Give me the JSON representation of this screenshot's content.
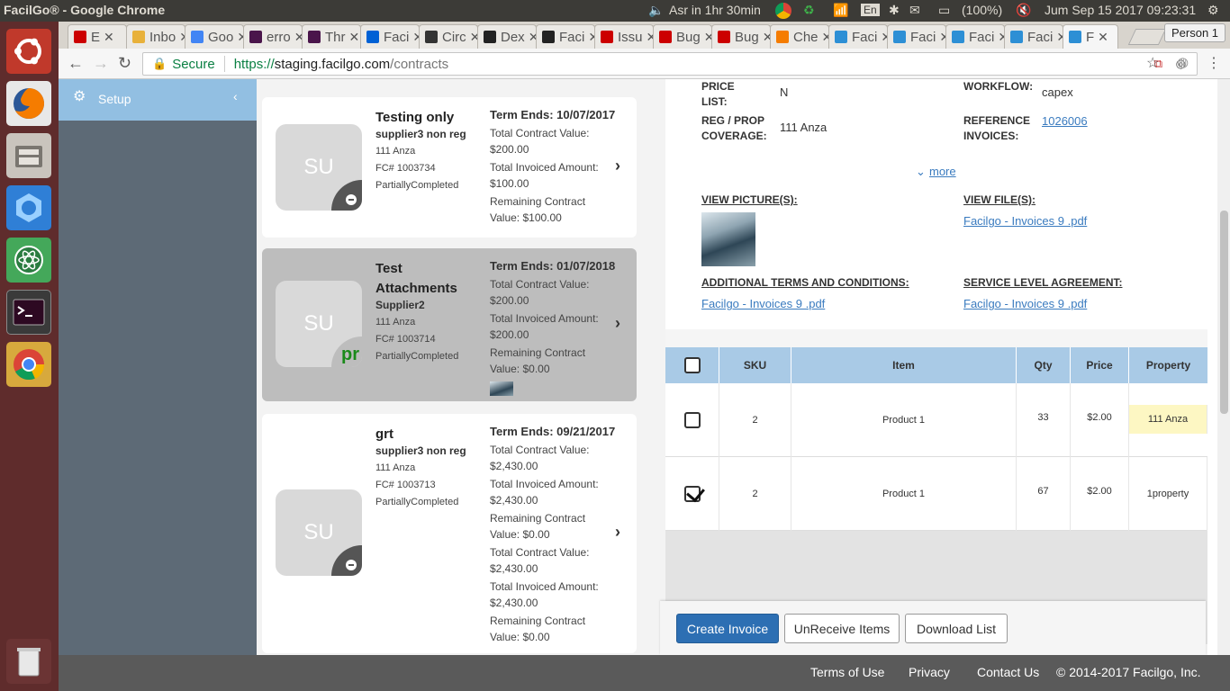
{
  "os_bar": {
    "window_title": "FacilGo® - Google Chrome",
    "prayer": "Asr in 1hr 30min",
    "keyboard": "En",
    "battery": "(100%)",
    "clock": "Jum Sep 15 2017 09:23:31"
  },
  "browser": {
    "tabs": [
      {
        "label": "E",
        "icon": "redhat-icon"
      },
      {
        "label": "Inbo",
        "icon": "mail-icon"
      },
      {
        "label": "Goo",
        "icon": "google-icon"
      },
      {
        "label": "erro",
        "icon": "slack-icon"
      },
      {
        "label": "Thr",
        "icon": "slack-icon"
      },
      {
        "label": "Faci",
        "icon": "box-icon"
      },
      {
        "label": "Circ",
        "icon": "circleci-icon"
      },
      {
        "label": "Dex",
        "icon": "github-icon"
      },
      {
        "label": "Faci",
        "icon": "github-icon"
      },
      {
        "label": "Issu",
        "icon": "redhat-icon"
      },
      {
        "label": "Bug",
        "icon": "redhat-icon"
      },
      {
        "label": "Bug",
        "icon": "redhat-icon"
      },
      {
        "label": "Che",
        "icon": "play-icon"
      },
      {
        "label": "Faci",
        "icon": "facilgo-icon"
      },
      {
        "label": "Faci",
        "icon": "facilgo-icon"
      },
      {
        "label": "Faci",
        "icon": "facilgo-icon"
      },
      {
        "label": "Faci",
        "icon": "facilgo-icon"
      },
      {
        "label": "F",
        "icon": "facilgo-icon"
      }
    ],
    "person": "Person 1",
    "secure_label": "Secure",
    "url_scheme": "https://",
    "url_host": "staging.facilgo.com",
    "url_path": "/contracts"
  },
  "sidebar": {
    "setup_label": "Setup"
  },
  "contracts": [
    {
      "avatar": "SU",
      "badge": "minus",
      "title": "Testing only",
      "supplier": "supplier3 non reg",
      "property": "111 Anza",
      "fc": "FC# 1003734",
      "status": "PartiallyCompleted",
      "term": "Term Ends: 10/07/2017",
      "values": [
        "Total Contract Value: $200.00",
        "Total Invoiced Amount: $100.00",
        "Remaining Contract Value: $100.00"
      ]
    },
    {
      "avatar": "SU",
      "badge": "pr",
      "title": "Test Attachments",
      "supplier": "Supplier2",
      "property": "111 Anza",
      "fc": "FC# 1003714",
      "status": "PartiallyCompleted",
      "term": "Term Ends: 01/07/2018",
      "values": [
        "Total Contract Value: $200.00",
        "Total Invoiced Amount: $200.00",
        "Remaining Contract Value: $0.00"
      ]
    },
    {
      "avatar": "SU",
      "badge": "minus",
      "title": "grt",
      "supplier": "supplier3 non reg",
      "property": "111 Anza",
      "fc": "FC# 1003713",
      "status": "PartiallyCompleted",
      "term": "Term Ends: 09/21/2017",
      "values": [
        "Total Contract Value: $2,430.00",
        "Total Invoiced Amount: $2,430.00",
        "Remaining Contract Value: $0.00",
        "Total Contract Value: $2,430.00",
        "Total Invoiced Amount: $2,430.00",
        "Remaining Contract Value: $0.00"
      ]
    }
  ],
  "detail": {
    "price_list_label": "PRICE LIST:",
    "price_list_value": "N",
    "workflow_label": "WORKFLOW:",
    "workflow_value": "capex",
    "reg_label": "REG / PROP COVERAGE:",
    "reg_value": "111 Anza",
    "ref_label": "REFERENCE INVOICES:",
    "ref_value": "1026006",
    "more": "more",
    "pictures_label": "VIEW PICTURE(S):",
    "files_label": "VIEW FILE(S):",
    "files_link": "Facilgo  - Invoices  9 .pdf",
    "terms_label": "ADDITIONAL TERMS AND CONDITIONS:",
    "terms_link": "Facilgo  - Invoices  9 .pdf",
    "sla_label": "SERVICE LEVEL AGREEMENT:",
    "sla_link": "Facilgo  - Invoices  9 .pdf"
  },
  "items_table": {
    "columns": [
      "SKU",
      "Item",
      "Qty",
      "Price",
      "Property"
    ],
    "rows": [
      {
        "checked": false,
        "sku": "2",
        "item": "Product 1",
        "qty": "33",
        "price": "$2.00",
        "property": "111 Anza"
      },
      {
        "checked": true,
        "sku": "2",
        "item": "Product 1",
        "qty": "67",
        "price": "$2.00",
        "property": "1property"
      }
    ]
  },
  "actions": {
    "create_invoice": "Create Invoice",
    "unreceive": "UnReceive Items",
    "download": "Download List"
  },
  "footer": {
    "terms": "Terms of Use",
    "privacy": "Privacy",
    "contact": "Contact Us",
    "copyright": "© 2014-2017 Facilgo, Inc."
  },
  "colors": {
    "primary_button": "#2d6fb3",
    "table_header": "#a9cae6",
    "setup_bg": "#92bfe2",
    "sidebar_bg": "#5d6a76",
    "launcher_bg": "#5f2c2c"
  }
}
